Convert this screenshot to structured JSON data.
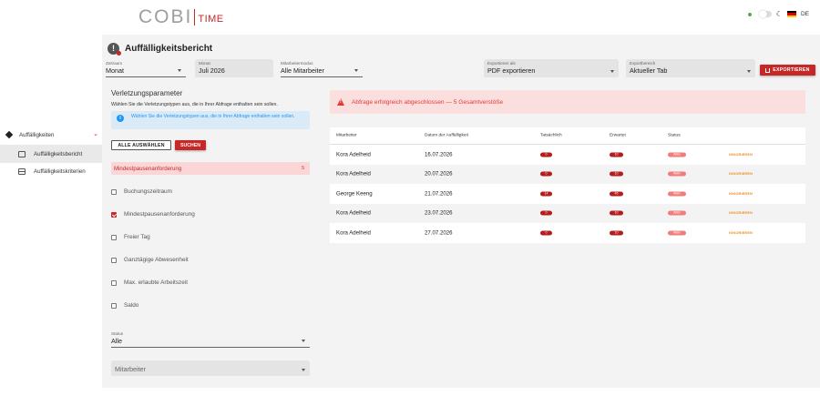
{
  "nav": {
    "group_label": "Auffälligkeiten",
    "items": [
      {
        "label": "Auffälligkeitsbericht",
        "icon": "report-icon",
        "active": true
      },
      {
        "label": "Auffälligkeitskriterien",
        "icon": "grid-icon",
        "active": false
      }
    ]
  },
  "header": {
    "logo_main": "COBI",
    "logo_sub": "TIME",
    "language": "DE"
  },
  "page": {
    "title": "Auffälligkeitsbericht",
    "filters": {
      "zeitraum_label": "Zeitraum",
      "zeitraum_value": "Monat",
      "monat_label": "Monat",
      "monat_value": "Juli 2026",
      "modus_label": "Mitarbeitermodus",
      "modus_value": "Alle Mitarbeiter",
      "export_as_label": "Exportieren als",
      "export_as_value": "PDF exportieren",
      "export_range_label": "Exportbereich",
      "export_range_value": "Aktueller Tab",
      "export_button": "EXPORTIEREN"
    }
  },
  "params": {
    "title": "Verletzungsparameter",
    "description": "Wählen Sie die Verletzungstypen aus, die in Ihrer Abfrage enthalten sein sollen.",
    "info": "Wählen Sie die Verletzungstypen aus, die in Ihrer Abfrage enthalten sein sollen.",
    "select_all": "ALLE AUSWÄHLEN",
    "search": "SUCHEN",
    "selected_chip": "Mindestpausenanforderung",
    "selected_count": "5",
    "checkboxes": [
      {
        "label": "Buchungszeitraum",
        "checked": false
      },
      {
        "label": "Mindestpausenanforderung",
        "checked": true
      },
      {
        "label": "Freier Tag",
        "checked": false
      },
      {
        "label": "Ganztägige Abwesenheit",
        "checked": false
      },
      {
        "label": "Max. erlaubte Arbeitszeit",
        "checked": false
      },
      {
        "label": "Saldo",
        "checked": false
      }
    ],
    "status_label": "Status",
    "status_value": "Alle",
    "employee_placeholder": "Mitarbeiter"
  },
  "alert": {
    "text": "Abfrage erfolgreich abgeschlossen — 5 Gesamtverstöße",
    "color": "#e53935"
  },
  "table": {
    "headers": [
      "Mitarbeiter",
      "Datum der Auffälligkeit",
      "Tatsächlich",
      "Erwartet",
      "Status"
    ],
    "rows": [
      {
        "name": "Kora Adelheid",
        "date": "16.07.2026",
        "actual": "0",
        "expected": "10",
        "status": "Aktiv",
        "action": "IGNORIEREN"
      },
      {
        "name": "Kora Adelheid",
        "date": "20.07.2026",
        "actual": "0",
        "expected": "10",
        "status": "Aktiv",
        "action": "IGNORIEREN"
      },
      {
        "name": "George Keeng",
        "date": "21.07.2026",
        "actual": "14",
        "expected": "45",
        "status": "Aktiv",
        "action": "IGNORIEREN"
      },
      {
        "name": "Kora Adelheid",
        "date": "23.07.2026",
        "actual": "0",
        "expected": "10",
        "status": "Aktiv",
        "action": "IGNORIEREN"
      },
      {
        "name": "Kora Adelheid",
        "date": "27.07.2026",
        "actual": "0",
        "expected": "10",
        "status": "Aktiv",
        "action": "IGNORIEREN"
      }
    ]
  },
  "colors": {
    "accent": "#c62828",
    "info": "#2196f3",
    "warning": "#ef8a17"
  }
}
